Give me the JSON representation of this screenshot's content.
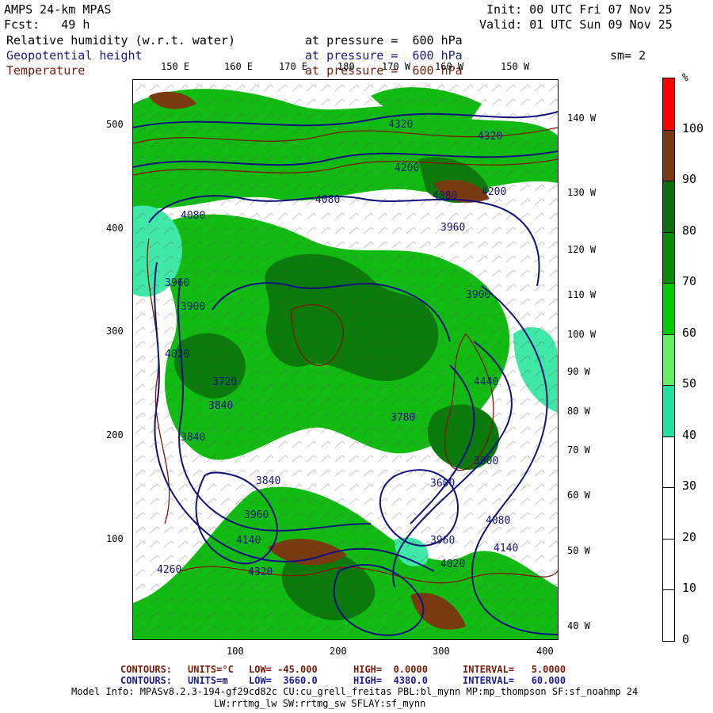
{
  "header": {
    "model": "AMPS 24-km MPAS",
    "init": "Init: 00 UTC Fri 07 Nov 25",
    "fcst": "Fcst:   49 h",
    "valid": "Valid: 01 UTC Sun 09 Nov 25",
    "field1": "Relative humidity (w.r.t. water)",
    "field1_level": "at pressure =  600 hPa",
    "field2": "Geopotential height",
    "field2_level": "at pressure =  600 hPa",
    "smooth": "sm= 2",
    "field3": "Temperature",
    "field3_level": "at pressure =  600 hPa",
    "colors": {
      "field1": "#000000",
      "field2": "#1a1a8a",
      "field3": "#7a1a0a"
    }
  },
  "top_longitudes": [
    "150 E",
    "160 E",
    "170 E",
    "180",
    "170 W",
    "160 W",
    "150 W"
  ],
  "right_longitudes": [
    "140 W",
    "130 W",
    "120 W",
    "110 W",
    "100 W",
    "90 W",
    "80 W",
    "70 W",
    "60 W",
    "50 W",
    "40 W"
  ],
  "y_axis_ticks": [
    "500",
    "400",
    "300",
    "200",
    "100"
  ],
  "x_axis_ticks": [
    "100",
    "200",
    "300",
    "400"
  ],
  "colorbar": {
    "unit": "%",
    "labels": [
      "100",
      "90",
      "80",
      "70",
      "60",
      "50",
      "40",
      "30",
      "20",
      "10",
      "0"
    ],
    "colors": [
      "#ff0000",
      "#7a3a10",
      "#0c6e0c",
      "#0a8a0a",
      "#00cc00",
      "#66ee66",
      "#20e0a0",
      "#ffffff",
      "#ffffff",
      "#ffffff",
      "#ffffff"
    ]
  },
  "height_contour_labels": [
    "4320",
    "4320",
    "4200",
    "4080",
    "4200",
    "4080",
    "4080",
    "3960",
    "3960",
    "3900",
    "4020",
    "3900",
    "3840",
    "3780",
    "3840",
    "3720",
    "3840",
    "3960",
    "4140",
    "4260",
    "4320",
    "4020",
    "4080",
    "3900",
    "3960",
    "4140",
    "4440",
    "3600"
  ],
  "footer": {
    "line1_label": "CONTOURS:",
    "line1_units": "UNITS=°C",
    "line1_low": "LOW= -45.000",
    "line1_high": "HIGH=  0.0000",
    "line1_interval": "INTERVAL=   5.0000",
    "line2_label": "CONTOURS:",
    "line2_units": "UNITS=m",
    "line2_low": "LOW=  3660.0",
    "line2_high": "HIGH=  4380.0",
    "line2_interval": "INTERVAL=   60.000",
    "model_info": "Model Info: MPASv8.2.3-194-gf29cd82c CU:cu_grell_freitas PBL:bl_mynn MP:mp_thompson SF:sf_noahmp 24",
    "model_info2": "LW:rrtmg_lw SW:rrtmg_sw SFLAY:sf_mynn"
  }
}
